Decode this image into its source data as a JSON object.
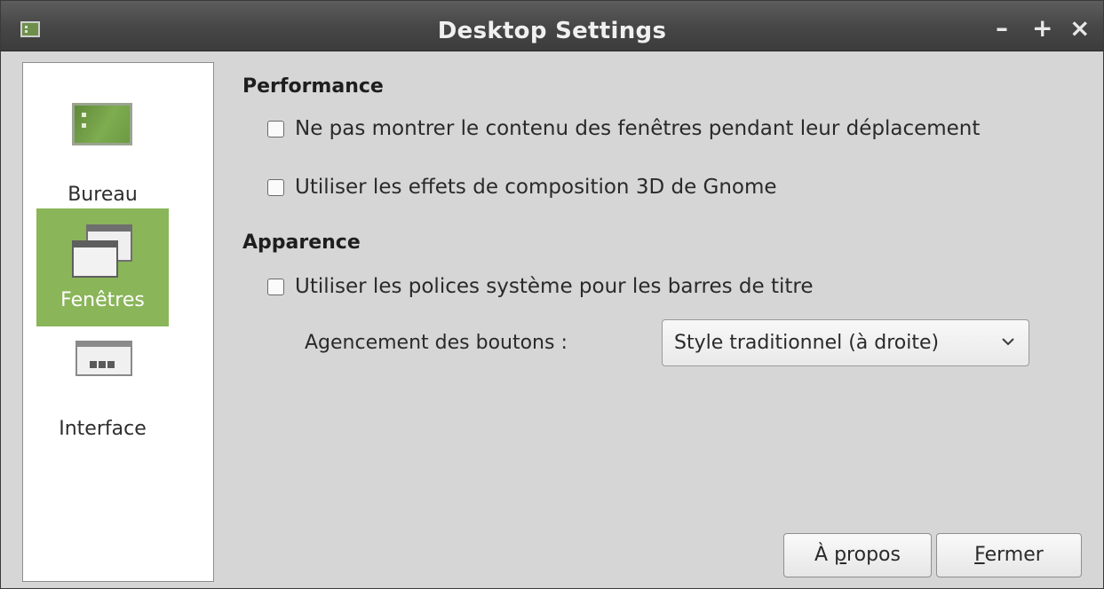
{
  "window": {
    "title": "Desktop Settings",
    "controls": {
      "minimize": "–",
      "maximize": "+",
      "close": "×"
    }
  },
  "sidebar": {
    "items": [
      {
        "label": "Bureau",
        "icon": "desktop-icon",
        "active": false
      },
      {
        "label": "Fenêtres",
        "icon": "windows-icon",
        "active": true
      },
      {
        "label": "Interface",
        "icon": "interface-icon",
        "active": false
      }
    ],
    "active_color": "#8ab559"
  },
  "main": {
    "performance": {
      "title": "Performance",
      "options": [
        {
          "label": "Ne pas montrer le contenu des fenêtres pendant leur déplacement",
          "checked": false
        },
        {
          "label": "Utiliser les effets de composition 3D de Gnome",
          "checked": false
        }
      ]
    },
    "appearance": {
      "title": "Apparence",
      "options": [
        {
          "label": "Utiliser les polices système pour les barres de titre",
          "checked": false
        }
      ],
      "button_layout": {
        "label": "Agencement des boutons :",
        "selected": "Style traditionnel (à droite)"
      }
    }
  },
  "footer": {
    "about_prefix": "À ",
    "about_mnemonic": "p",
    "about_rest": "ropos",
    "close_mnemonic": "F",
    "close_rest": "ermer"
  }
}
